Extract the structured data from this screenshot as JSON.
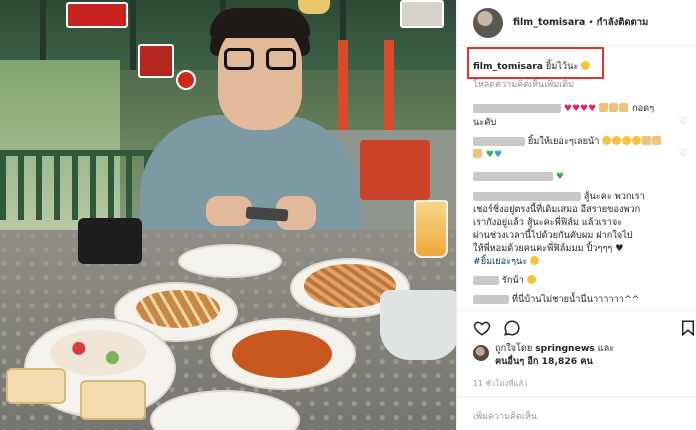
{
  "post": {
    "username": "film_tomisara",
    "separator": "•",
    "follow_status": "กำลังติดตาม"
  },
  "caption": {
    "username": "film_tomisara",
    "text": "ยิ้มไว้นะ"
  },
  "load_more": "โหลดความคิดเห็นเพิ่มเติม",
  "comments": {
    "c1_text": "กอดๆ",
    "c1_text2": "นะคับ",
    "c2_text": "ยิ้มให้เยอะๆเลยน้า",
    "c4_line1": "สู้นะคะ พวกเรา",
    "c4_line2": "เชอร์ชิ่งอยู่ตรงนี้ที่เดิมเสมอ อีสรายของพวก",
    "c4_line3": "เรากังอยู่แล้ว สู้นะคะพี่ฟิล์ม แล้วเราจะ",
    "c4_line4": "ผ่านช่วงเวลานี้ไปด้วยกันคับผม ฝากใจไป",
    "c4_line5": "ให้พี่หอมด้วยคนคะพี่ฟิล์มมม ปิ้วๆๆๆ",
    "c4_hashtag": "#ยิ้มเยอะๆนะ",
    "c5_text": "รักน้า",
    "c6_text": "ที่นี่บ้านไม่ชายน้ำนี่นาาาาาา^^"
  },
  "likes": {
    "prefix": "ถูกใจโดย",
    "liker": "springnews",
    "and": "และ",
    "others_label": "คนอื่นๆ อีก",
    "count": "18,826",
    "unit": "คน"
  },
  "time_ago": "11 ชั่วโมงที่แล้ว",
  "add_comment_placeholder": "เพิ่มความคิดเห็น",
  "icons": {
    "like": "heart-outline-icon",
    "comment": "speech-bubble-icon",
    "save": "bookmark-icon",
    "comment_like": "small-heart-icon"
  },
  "colors": {
    "highlight": "#e4312b",
    "hashtag": "#003569",
    "muted": "#8e8e8e"
  }
}
